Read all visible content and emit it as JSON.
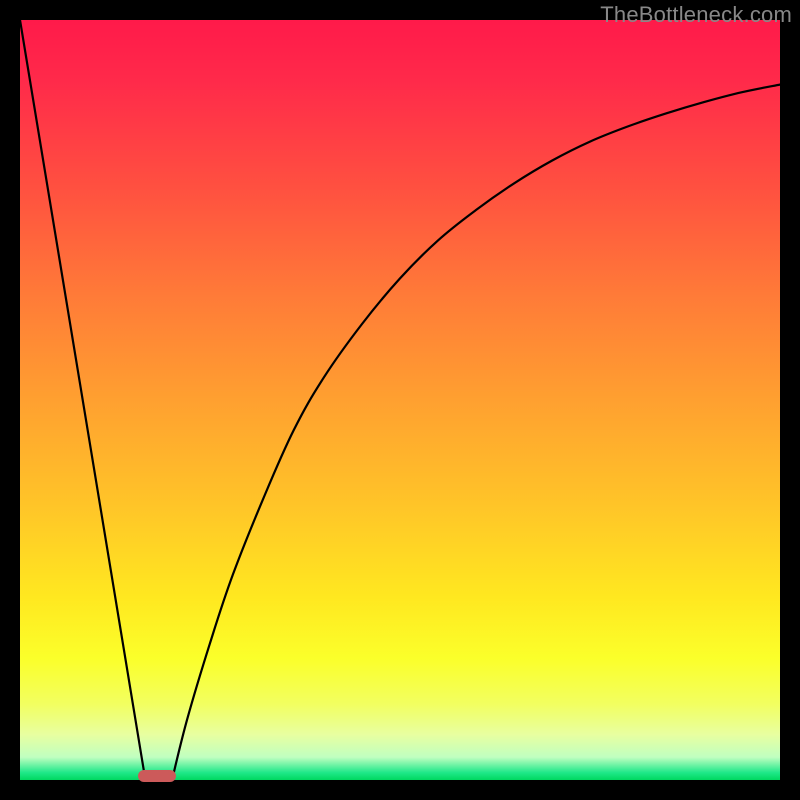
{
  "watermark": "TheBottleneck.com",
  "chart_data": {
    "type": "line",
    "title": "",
    "xlabel": "",
    "ylabel": "",
    "xlim": [
      0,
      100
    ],
    "ylim": [
      0,
      100
    ],
    "series": [
      {
        "name": "left-line",
        "x": [
          0,
          16.5
        ],
        "y": [
          100,
          0
        ]
      },
      {
        "name": "right-curve",
        "x": [
          20,
          22,
          25,
          28,
          32,
          36,
          40,
          45,
          50,
          55,
          60,
          65,
          70,
          75,
          80,
          85,
          90,
          95,
          100
        ],
        "y": [
          0,
          8,
          18,
          27,
          37,
          46,
          53,
          60,
          66,
          71,
          75,
          78.5,
          81.5,
          84,
          86,
          87.7,
          89.2,
          90.5,
          91.5
        ]
      }
    ],
    "annotations": [
      {
        "type": "marker",
        "shape": "rounded-rect",
        "x_center": 18,
        "width_pct": 5,
        "y": 0.5,
        "color": "#cc5a5a"
      }
    ],
    "gradient_background": {
      "direction": "top-to-bottom",
      "stops": [
        {
          "at": 0,
          "color": "#ff1a4a"
        },
        {
          "at": 50,
          "color": "#ffa030"
        },
        {
          "at": 85,
          "color": "#fbff2a"
        },
        {
          "at": 99,
          "color": "#20e88a"
        },
        {
          "at": 100,
          "color": "#00d860"
        }
      ]
    },
    "frame": {
      "border_width_px": 20,
      "border_color": "#000000"
    }
  }
}
